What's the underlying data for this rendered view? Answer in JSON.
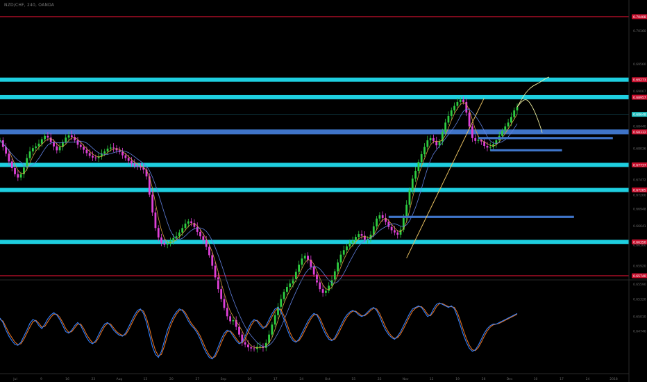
{
  "header": {
    "symbol": "NZD/CHF, 240, OANDA"
  },
  "colors": {
    "background": "#000000",
    "red_line": "#c8102e",
    "cyan_line": "#1ecfe0",
    "blue_zone": "#3f74c8",
    "candle_up": "#2ecc40",
    "candle_down": "#e040d8",
    "ma_fast": "#d8a040",
    "ma_slow": "#6080e0",
    "trendline": "#e8c060",
    "projection": "#f0f0a0",
    "osc_k": "#3080ff",
    "osc_d": "#e07020",
    "axis_text": "#6a6a6a",
    "current_price_bg": "#20c0c0"
  },
  "chart_data": {
    "type": "candlestick",
    "symbol": "NZD/CHF",
    "timeframe": "240",
    "source": "OANDA",
    "price_axis_ticks": [
      "0.70160",
      "0.69560",
      "0.69067",
      "0.68440",
      "0.68036",
      "0.67760",
      "0.67472",
      "0.67200",
      "0.66948",
      "0.66641",
      "0.66300",
      "0.65920",
      "0.65590",
      "0.65320",
      "0.65010",
      "0.64746"
    ],
    "price_levels": [
      {
        "kind": "red-line",
        "price": 0.70408,
        "label": "0.70408"
      },
      {
        "kind": "cyan-line",
        "price": 0.69273,
        "label": "0.69273"
      },
      {
        "kind": "cyan-line",
        "price": 0.68957,
        "label": "0.68957"
      },
      {
        "kind": "blue-zone",
        "price": 0.68332,
        "label": "0.68332"
      },
      {
        "kind": "cyan-line",
        "price": 0.67737,
        "label": "0.67737"
      },
      {
        "kind": "cyan-line",
        "price": 0.67285,
        "label": "0.67285"
      },
      {
        "kind": "cyan-line",
        "price": 0.6635,
        "label": "0.66350"
      },
      {
        "kind": "red-line",
        "price": 0.6574,
        "label": "0.65740"
      }
    ],
    "current_price": {
      "price": 0.68648,
      "label": "0.68648"
    },
    "support_blue_segments": [
      {
        "from_index": 160,
        "to_index": 205,
        "price": 0.6822
      },
      {
        "from_index": 164,
        "to_index": 188,
        "price": 0.68
      },
      {
        "from_index": 130,
        "to_index": 192,
        "price": 0.668
      }
    ],
    "trendline": {
      "from_index": 136,
      "from_price": 0.6606,
      "to_index": 161,
      "to_price": 0.6894
    },
    "x_ticks": [
      "Jul",
      "9",
      "16",
      "23",
      "Aug",
      "13",
      "20",
      "27",
      "Sep",
      "10",
      "17",
      "24",
      "Oct",
      "15",
      "22",
      "Nov",
      "12",
      "19",
      "26",
      "Dec",
      "10",
      "17",
      "24",
      "2018"
    ],
    "close_series": [
      0.6818,
      0.6806,
      0.6794,
      0.678,
      0.6768,
      0.6757,
      0.6751,
      0.6757,
      0.6769,
      0.6786,
      0.6798,
      0.6804,
      0.6807,
      0.6812,
      0.682,
      0.6826,
      0.6823,
      0.6815,
      0.6807,
      0.68,
      0.6806,
      0.6815,
      0.6823,
      0.6827,
      0.6824,
      0.6818,
      0.681,
      0.6806,
      0.6801,
      0.6795,
      0.679,
      0.6787,
      0.6786,
      0.6789,
      0.6794,
      0.6798,
      0.6803,
      0.6805,
      0.6804,
      0.68,
      0.6797,
      0.6791,
      0.6786,
      0.6781,
      0.6776,
      0.6772,
      0.6771,
      0.6769,
      0.6765,
      0.6753,
      0.672,
      0.6688,
      0.666,
      0.6643,
      0.6633,
      0.663,
      0.6632,
      0.6637,
      0.6642,
      0.6645,
      0.6652,
      0.666,
      0.6668,
      0.6672,
      0.6669,
      0.6662,
      0.6653,
      0.6645,
      0.6638,
      0.6626,
      0.6611,
      0.6592,
      0.6571,
      0.655,
      0.6532,
      0.6516,
      0.6501,
      0.6492,
      0.6494,
      0.6482,
      0.6468,
      0.6454,
      0.645,
      0.6445,
      0.6443,
      0.6442,
      0.6446,
      0.6447,
      0.6444,
      0.6453,
      0.6468,
      0.6486,
      0.6503,
      0.6518,
      0.6532,
      0.6545,
      0.6554,
      0.656,
      0.6568,
      0.6581,
      0.6594,
      0.6605,
      0.661,
      0.6603,
      0.659,
      0.6576,
      0.6562,
      0.655,
      0.6543,
      0.6547,
      0.6556,
      0.6567,
      0.6582,
      0.6598,
      0.6612,
      0.662,
      0.6627,
      0.6633,
      0.6637,
      0.6644,
      0.6649,
      0.6646,
      0.6639,
      0.664,
      0.6648,
      0.6663,
      0.6677,
      0.6683,
      0.6678,
      0.6671,
      0.6662,
      0.6656,
      0.6652,
      0.6648,
      0.6657,
      0.6678,
      0.6702,
      0.6728,
      0.6749,
      0.6763,
      0.6779,
      0.6793,
      0.6806,
      0.6818,
      0.6822,
      0.6817,
      0.6809,
      0.6816,
      0.6833,
      0.685,
      0.6862,
      0.6872,
      0.688,
      0.6887,
      0.6891,
      0.6887,
      0.6868,
      0.6843,
      0.6822,
      0.6817,
      0.6819,
      0.6816,
      0.6808,
      0.6805,
      0.6806,
      0.6811,
      0.6818,
      0.6826,
      0.6835,
      0.6843,
      0.685,
      0.686,
      0.6872,
      0.6878
    ],
    "oscillator_k": [
      68,
      62,
      52,
      44,
      38,
      33,
      32,
      36,
      44,
      52,
      61,
      66,
      64,
      58,
      54,
      60,
      67,
      72,
      75,
      72,
      66,
      58,
      50,
      48,
      52,
      58,
      62,
      58,
      50,
      42,
      36,
      34,
      38,
      46,
      54,
      60,
      62,
      58,
      52,
      48,
      45,
      44,
      48,
      56,
      64,
      72,
      78,
      80,
      74,
      62,
      46,
      30,
      20,
      16,
      24,
      38,
      52,
      62,
      70,
      76,
      80,
      78,
      72,
      64,
      58,
      54,
      48,
      40,
      30,
      22,
      16,
      14,
      20,
      30,
      40,
      48,
      52,
      50,
      44,
      38,
      34,
      36,
      44,
      54,
      62,
      66,
      64,
      58,
      54,
      58,
      66,
      74,
      80,
      82,
      76,
      66,
      54,
      44,
      38,
      36,
      40,
      48,
      56,
      64,
      70,
      74,
      72,
      64,
      54,
      46,
      40,
      38,
      42,
      50,
      58,
      66,
      72,
      76,
      78,
      76,
      72,
      70,
      72,
      76,
      80,
      82,
      78,
      70,
      60,
      52,
      46,
      42,
      40,
      44,
      50,
      58,
      66,
      74,
      80,
      82,
      84,
      82,
      76,
      70,
      72,
      80,
      86,
      88,
      86,
      84,
      82,
      84,
      80,
      70,
      58,
      46,
      36,
      28,
      24,
      26,
      32,
      40,
      48,
      54,
      58,
      60,
      60,
      62,
      64,
      66,
      68,
      70,
      72,
      74
    ],
    "oscillator_d": [
      66,
      64,
      56,
      48,
      42,
      36,
      33,
      34,
      40,
      48,
      56,
      63,
      65,
      61,
      56,
      57,
      63,
      69,
      73,
      73,
      69,
      62,
      54,
      49,
      50,
      55,
      60,
      60,
      54,
      46,
      40,
      35,
      36,
      42,
      50,
      57,
      61,
      60,
      55,
      50,
      47,
      45,
      46,
      52,
      60,
      68,
      75,
      79,
      77,
      68,
      54,
      38,
      25,
      18,
      20,
      31,
      45,
      57,
      66,
      73,
      78,
      79,
      75,
      68,
      61,
      56,
      51,
      44,
      35,
      26,
      19,
      15,
      17,
      25,
      35,
      44,
      50,
      51,
      47,
      41,
      36,
      35,
      40,
      49,
      58,
      64,
      65,
      61,
      56,
      56,
      62,
      70,
      77,
      81,
      79,
      71,
      60,
      49,
      41,
      37,
      38,
      44,
      52,
      60,
      67,
      72,
      73,
      68,
      59,
      50,
      43,
      39,
      40,
      46,
      54,
      62,
      69,
      74,
      77,
      77,
      74,
      71,
      71,
      74,
      78,
      81,
      80,
      74,
      65,
      56,
      49,
      44,
      41,
      42,
      47,
      54,
      62,
      70,
      77,
      81,
      83,
      83,
      79,
      73,
      71,
      76,
      83,
      87,
      87,
      85,
      83,
      83,
      82,
      75,
      64,
      52,
      41,
      32,
      26,
      25,
      29,
      36,
      44,
      51,
      56,
      59,
      60,
      61,
      63,
      65,
      67,
      69,
      71,
      73
    ]
  }
}
